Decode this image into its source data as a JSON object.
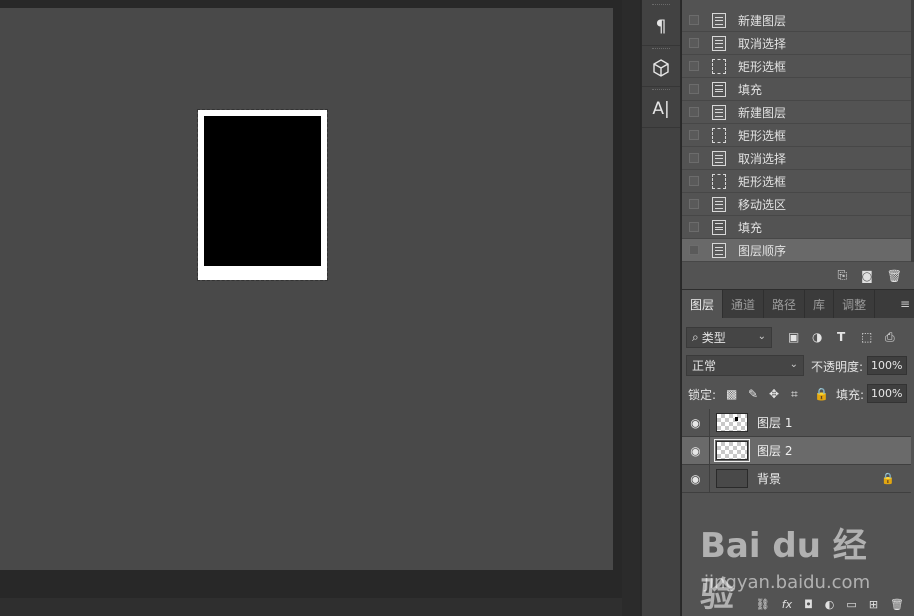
{
  "history": {
    "items": [
      {
        "label": "新建图层",
        "icon": "document-icon",
        "selected": false
      },
      {
        "label": "取消选择",
        "icon": "document-icon",
        "selected": false
      },
      {
        "label": "矩形选框",
        "icon": "marquee-icon",
        "selected": false
      },
      {
        "label": "填充",
        "icon": "fill-icon",
        "selected": false
      },
      {
        "label": "新建图层",
        "icon": "document-icon",
        "selected": false
      },
      {
        "label": "矩形选框",
        "icon": "marquee-icon",
        "selected": false
      },
      {
        "label": "取消选择",
        "icon": "document-icon",
        "selected": false
      },
      {
        "label": "矩形选框",
        "icon": "marquee-icon",
        "selected": false
      },
      {
        "label": "移动选区",
        "icon": "document-icon",
        "selected": false
      },
      {
        "label": "填充",
        "icon": "fill-icon",
        "selected": false
      },
      {
        "label": "图层顺序",
        "icon": "document-icon",
        "selected": true
      }
    ]
  },
  "tools": [
    {
      "icon": "paragraph-icon",
      "glyph": "¶"
    },
    {
      "icon": "3d-cube-icon",
      "glyph": "⬡"
    },
    {
      "icon": "character-icon",
      "glyph": "A|"
    }
  ],
  "layers_panel": {
    "tabs": [
      {
        "label": "图层",
        "active": true
      },
      {
        "label": "通道",
        "active": false
      },
      {
        "label": "路径",
        "active": false
      },
      {
        "label": "库",
        "active": false
      },
      {
        "label": "调整",
        "active": false
      }
    ],
    "filter_label": "类型",
    "blend_mode": "正常",
    "opacity_label": "不透明度:",
    "opacity_value": "100%",
    "lock_label": "锁定:",
    "fill_label": "填充:",
    "fill_value": "100%",
    "layers": [
      {
        "name": "图层 1",
        "visible": true,
        "selected": false,
        "locked": false
      },
      {
        "name": "图层 2",
        "visible": true,
        "selected": true,
        "locked": false
      },
      {
        "name": "背景",
        "visible": true,
        "selected": false,
        "locked": true
      }
    ]
  },
  "watermark": {
    "logo": "Bai du 经验",
    "url": "jingyan.baidu.com"
  },
  "colors": {
    "canvas_bg": "#494949",
    "panel_bg": "#535353",
    "selected_row": "#696969"
  }
}
